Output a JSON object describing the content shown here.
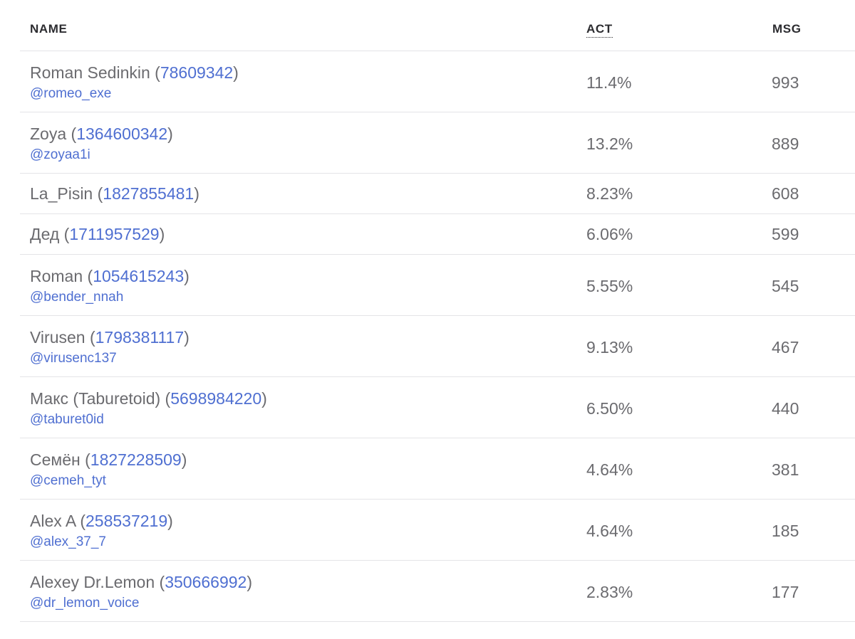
{
  "columns": {
    "name": "NAME",
    "act": "ACT",
    "msg": "MSG"
  },
  "rows": [
    {
      "name": "Roman Sedinkin",
      "id": "78609342",
      "handle": "@romeo_exe",
      "act": "11.4%",
      "msg": "993"
    },
    {
      "name": "Zoya",
      "id": "1364600342",
      "handle": "@zoyaa1i",
      "act": "13.2%",
      "msg": "889"
    },
    {
      "name": "La_Pisin",
      "id": "1827855481",
      "handle": "",
      "act": "8.23%",
      "msg": "608"
    },
    {
      "name": "Дед",
      "id": "1711957529",
      "handle": "",
      "act": "6.06%",
      "msg": "599"
    },
    {
      "name": "Roman",
      "id": "1054615243",
      "handle": "@bender_nnah",
      "act": "5.55%",
      "msg": "545"
    },
    {
      "name": "Virusen",
      "id": "1798381117",
      "handle": "@virusenc137",
      "act": "9.13%",
      "msg": "467"
    },
    {
      "name": "Макс (Taburetoid)",
      "id": "5698984220",
      "handle": "@taburet0id",
      "act": "6.50%",
      "msg": "440"
    },
    {
      "name": "Семён",
      "id": "1827228509",
      "handle": "@cemeh_tyt",
      "act": "4.64%",
      "msg": "381"
    },
    {
      "name": "Alex A",
      "id": "258537219",
      "handle": "@alex_37_7",
      "act": "4.64%",
      "msg": "185"
    },
    {
      "name": "Alexey Dr.Lemon",
      "id": "350666992",
      "handle": "@dr_lemon_voice",
      "act": "2.83%",
      "msg": "177"
    }
  ]
}
